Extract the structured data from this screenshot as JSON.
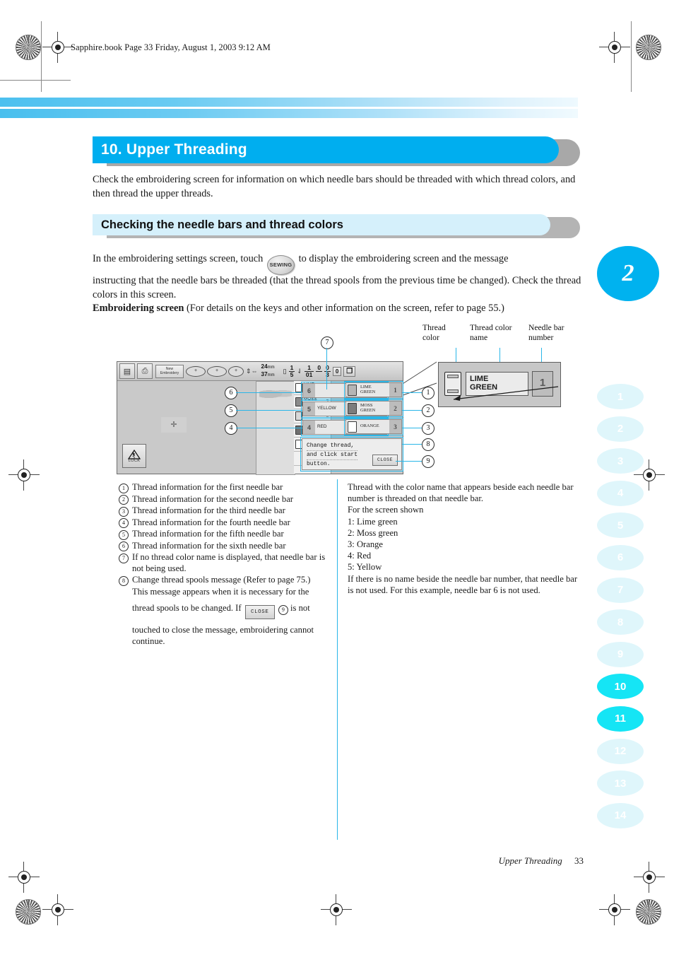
{
  "header": {
    "filestamp": "Sapphire.book  Page 33  Friday, August 1, 2003  9:12 AM"
  },
  "section": {
    "title": "10. Upper Threading",
    "intro": "Check the embroidering screen for information on which needle bars should be threaded with which thread colors, and then thread the upper threads.",
    "subtitle": "Checking the needle bars and thread colors"
  },
  "body": {
    "p1_before": "In the embroidering settings screen, touch",
    "sewing_key_label": "SEWING",
    "p1_after": "to display the embroidering screen and the message",
    "p2": "instructing that the needle bars be threaded (that the thread spools from the previous time be changed). Check the thread colors in this screen.",
    "p3_bold": "Embroidering screen",
    "p3_rest": " (For details on the keys and other information on the screen, refer to page 55.)"
  },
  "detail_callout": {
    "labels": {
      "thread_color": "Thread\ncolor",
      "thread_color_name": "Thread color\nname",
      "needle_bar_number": "Needle bar\nnumber"
    },
    "sample": {
      "color_name": "LIME\nGREEN",
      "needle_number": "1"
    }
  },
  "screen": {
    "toolbar": {
      "new_embroidery_label": "New\nEmbroidery",
      "dim_width": "24",
      "dim_height": "37",
      "dim_unit": "mm",
      "stitch_frac_top": "1",
      "stitch_frac_bottom": "5",
      "color_frac_top": "1",
      "color_frac_bottom": "1",
      "count_01": "01",
      "count_0": "0",
      "time_0min": "0",
      "time_3min": "3",
      "time_unit": "min",
      "bobbin_time": "0"
    },
    "lock_label": "LOCK",
    "color_list": [
      {
        "num": "1",
        "name": "LIME\nGREEN"
      },
      {
        "num": "2",
        "name": "MOSS\nGREEN"
      },
      {
        "num": "3",
        "name": "ORANGE"
      },
      {
        "num": "4",
        "name": "RED"
      },
      {
        "num": "5",
        "name": "YELLOW"
      }
    ],
    "thread_keys_left": [
      {
        "num": "6",
        "name": ""
      },
      {
        "num": "5",
        "name": "YELLOW"
      },
      {
        "num": "4",
        "name": "RED"
      }
    ],
    "thread_keys_right": [
      {
        "num": "1",
        "name": "LIME\nGREEN"
      },
      {
        "num": "2",
        "name": "MOSS\nGREEN"
      },
      {
        "num": "3",
        "name": "ORANGE"
      }
    ],
    "message": {
      "line1": "Change thread,",
      "line2": "and click start",
      "line3": "button.",
      "close_label": "CLOSE"
    }
  },
  "callouts": {
    "c1": "1",
    "c2": "2",
    "c3": "3",
    "c4": "4",
    "c5": "5",
    "c6": "6",
    "c7": "7",
    "c8": "8",
    "c9": "9"
  },
  "legend": {
    "items": [
      {
        "num": "1",
        "text": "Thread information for the first needle bar"
      },
      {
        "num": "2",
        "text": "Thread information for the second needle bar"
      },
      {
        "num": "3",
        "text": "Thread information for the third needle bar"
      },
      {
        "num": "4",
        "text": "Thread information for the fourth needle bar"
      },
      {
        "num": "5",
        "text": "Thread information for the fifth needle bar"
      },
      {
        "num": "6",
        "text": "Thread information for the sixth needle bar"
      },
      {
        "num": "7",
        "text": "If no thread color name is displayed, that needle bar is not being used."
      }
    ],
    "item8": {
      "num": "8",
      "line1": "Change thread spools message (Refer to page 75.)",
      "line2": "This message appears when it is necessary for the",
      "line3a": "thread spools to be changed. If",
      "close_key": "CLOSE",
      "circ9": "9",
      "line3b": "is not",
      "line4": "touched to close the message, embroidering cannot continue."
    }
  },
  "right_column": {
    "para1": "Thread with the color name that appears beside each needle bar number is threaded on that needle bar.",
    "para2": "For the screen shown",
    "list": [
      "1: Lime green",
      "2: Moss green",
      "3: Orange",
      "4: Red",
      "5: Yellow"
    ],
    "para3": "If there is no name beside the needle bar number, that needle bar is not used. For this example, needle bar 6 is not used."
  },
  "side_index": {
    "chapter": "2",
    "pills": [
      {
        "label": "1",
        "active": false
      },
      {
        "label": "2",
        "active": false
      },
      {
        "label": "3",
        "active": false
      },
      {
        "label": "4",
        "active": false
      },
      {
        "label": "5",
        "active": false
      },
      {
        "label": "6",
        "active": false
      },
      {
        "label": "7",
        "active": false
      },
      {
        "label": "8",
        "active": false
      },
      {
        "label": "9",
        "active": false
      },
      {
        "label": "10",
        "active": true
      },
      {
        "label": "11",
        "active": true
      },
      {
        "label": "12",
        "active": false
      },
      {
        "label": "13",
        "active": false
      },
      {
        "label": "14",
        "active": false
      }
    ]
  },
  "footer": {
    "running_title": "Upper Threading",
    "page_number": "33"
  },
  "colors": {
    "accent_blue": "#00aeef",
    "light_blue": "#d5f0fb",
    "pill_active": "#15e5f5",
    "pill_inactive": "#dff6fb",
    "leader_blue": "#29b6e8"
  }
}
